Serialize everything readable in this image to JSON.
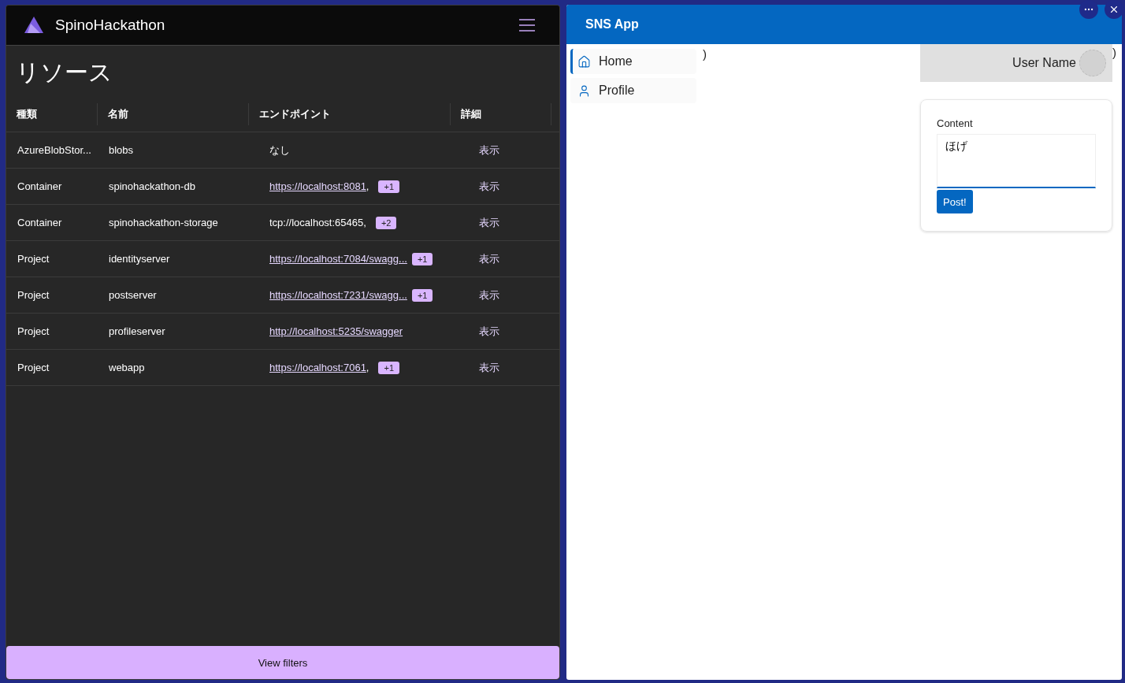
{
  "left_app": {
    "brand": "SpinoHackathon",
    "page_title": "リソース",
    "table": {
      "columns": [
        "種類",
        "名前",
        "エンドポイント",
        "詳細"
      ],
      "rows": [
        {
          "type": "AzureBlobStor...",
          "name": "blobs",
          "endpoint": {
            "kind": "text",
            "text": "なし"
          },
          "details": "表示"
        },
        {
          "type": "Container",
          "name": "spinohackathon-db",
          "endpoint": {
            "kind": "link",
            "text": "https://localhost:8081",
            "separator": ",",
            "badge": "+1"
          },
          "details": "表示"
        },
        {
          "type": "Container",
          "name": "spinohackathon-storage",
          "endpoint": {
            "kind": "text",
            "text": "tcp://localhost:65465",
            "separator": ",",
            "badge": "+2"
          },
          "details": "表示"
        },
        {
          "type": "Project",
          "name": "identityserver",
          "endpoint": {
            "kind": "link",
            "text": "https://localhost:7084/swagg...",
            "badge": "+1"
          },
          "details": "表示"
        },
        {
          "type": "Project",
          "name": "postserver",
          "endpoint": {
            "kind": "link",
            "text": "https://localhost:7231/swagg...",
            "badge": "+1"
          },
          "details": "表示"
        },
        {
          "type": "Project",
          "name": "profileserver",
          "endpoint": {
            "kind": "link",
            "text": "http://localhost:5235/swagger"
          },
          "details": "表示"
        },
        {
          "type": "Project",
          "name": "webapp",
          "endpoint": {
            "kind": "link",
            "text": "https://localhost:7061",
            "separator": ",",
            "badge": "+1"
          },
          "details": "表示"
        }
      ]
    },
    "filter_button": "View filters"
  },
  "right_app": {
    "title": "SNS App",
    "nav": [
      {
        "label": "Home",
        "selected": true
      },
      {
        "label": "Profile",
        "selected": false
      }
    ],
    "stray_texts": [
      ")",
      ")"
    ],
    "user_name": "User Name",
    "post_form": {
      "label": "Content",
      "value": "ほげ",
      "button": "Post!"
    }
  }
}
